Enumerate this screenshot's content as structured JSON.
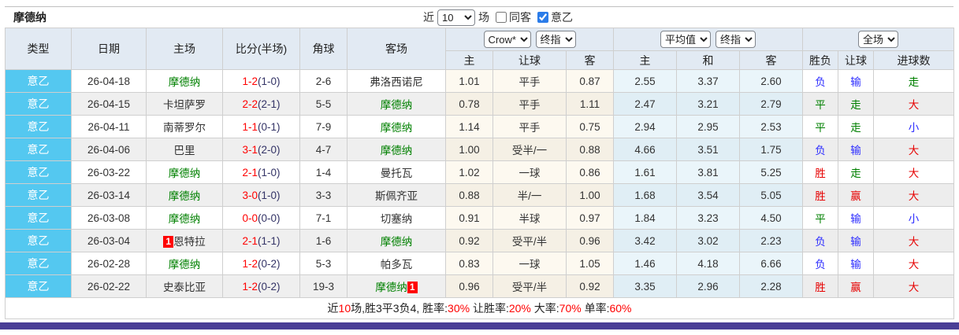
{
  "title": "摩德纳",
  "controls": {
    "recent_label": "近",
    "recent_value": "10",
    "unit_label": "场",
    "same_away_label": "同客",
    "same_away_checked": false,
    "league_filter_label": "意乙",
    "league_filter_checked": true
  },
  "table": {
    "col_headers": {
      "type": "类型",
      "date": "日期",
      "home": "主场",
      "score_half": "比分(半场)",
      "corner": "角球",
      "away": "客场",
      "odds_sub": [
        "主",
        "让球",
        "客"
      ],
      "avg_sub": [
        "主",
        "和",
        "客"
      ],
      "result_sub": [
        "胜负",
        "让球",
        "进球数"
      ]
    },
    "selects": {
      "odds_provider": "Crow*",
      "odds_stage": "终指",
      "avg_type": "平均值",
      "avg_stage": "终指",
      "scope": "全场"
    },
    "value_colors": {
      "胜": "red",
      "负": "blue",
      "平": "green",
      "赢": "red",
      "输": "blue",
      "走": "green",
      "大": "red",
      "小": "blue"
    },
    "rows": [
      {
        "type": "意乙",
        "date": "26-04-18",
        "home": {
          "name": "摩德纳"
        },
        "score_ft": "1-2",
        "score_ht": "1-0",
        "corner": "2-6",
        "away": {
          "name": "弗洛西诺尼"
        },
        "odds": [
          "1.01",
          "平手",
          "0.87"
        ],
        "avg": [
          "2.55",
          "3.37",
          "2.60"
        ],
        "result": [
          "负",
          "输",
          "走"
        ]
      },
      {
        "type": "意乙",
        "date": "26-04-15",
        "home": {
          "name": "卡坦萨罗"
        },
        "score_ft": "2-2",
        "score_ht": "2-1",
        "corner": "5-5",
        "away": {
          "name": "摩德纳"
        },
        "odds": [
          "0.78",
          "平手",
          "1.11"
        ],
        "avg": [
          "2.47",
          "3.21",
          "2.79"
        ],
        "result": [
          "平",
          "走",
          "大"
        ]
      },
      {
        "type": "意乙",
        "date": "26-04-11",
        "home": {
          "name": "南蒂罗尔"
        },
        "score_ft": "1-1",
        "score_ht": "0-1",
        "corner": "7-9",
        "away": {
          "name": "摩德纳"
        },
        "odds": [
          "1.14",
          "平手",
          "0.75"
        ],
        "avg": [
          "2.94",
          "2.95",
          "2.53"
        ],
        "result": [
          "平",
          "走",
          "小"
        ]
      },
      {
        "type": "意乙",
        "date": "26-04-06",
        "home": {
          "name": "巴里"
        },
        "score_ft": "3-1",
        "score_ht": "2-0",
        "corner": "4-7",
        "away": {
          "name": "摩德纳"
        },
        "odds": [
          "1.00",
          "受半/一",
          "0.88"
        ],
        "avg": [
          "4.66",
          "3.51",
          "1.75"
        ],
        "result": [
          "负",
          "输",
          "大"
        ]
      },
      {
        "type": "意乙",
        "date": "26-03-22",
        "home": {
          "name": "摩德纳"
        },
        "score_ft": "2-1",
        "score_ht": "1-0",
        "corner": "1-4",
        "away": {
          "name": "曼托瓦"
        },
        "odds": [
          "1.02",
          "一球",
          "0.86"
        ],
        "avg": [
          "1.61",
          "3.81",
          "5.25"
        ],
        "result": [
          "胜",
          "走",
          "大"
        ]
      },
      {
        "type": "意乙",
        "date": "26-03-14",
        "home": {
          "name": "摩德纳"
        },
        "score_ft": "3-0",
        "score_ht": "1-0",
        "corner": "3-3",
        "away": {
          "name": "斯佩齐亚"
        },
        "odds": [
          "0.88",
          "半/一",
          "1.00"
        ],
        "avg": [
          "1.68",
          "3.54",
          "5.05"
        ],
        "result": [
          "胜",
          "赢",
          "大"
        ]
      },
      {
        "type": "意乙",
        "date": "26-03-08",
        "home": {
          "name": "摩德纳"
        },
        "score_ft": "0-0",
        "score_ht": "0-0",
        "corner": "7-1",
        "away": {
          "name": "切塞纳"
        },
        "odds": [
          "0.91",
          "半球",
          "0.97"
        ],
        "avg": [
          "1.84",
          "3.23",
          "4.50"
        ],
        "result": [
          "平",
          "输",
          "小"
        ]
      },
      {
        "type": "意乙",
        "date": "26-03-04",
        "home": {
          "name": "恩特拉",
          "badge_before": "1"
        },
        "score_ft": "2-1",
        "score_ht": "1-1",
        "corner": "1-6",
        "away": {
          "name": "摩德纳"
        },
        "odds": [
          "0.92",
          "受平/半",
          "0.96"
        ],
        "avg": [
          "3.42",
          "3.02",
          "2.23"
        ],
        "result": [
          "负",
          "输",
          "大"
        ]
      },
      {
        "type": "意乙",
        "date": "26-02-28",
        "home": {
          "name": "摩德纳"
        },
        "score_ft": "1-2",
        "score_ht": "0-2",
        "corner": "5-3",
        "away": {
          "name": "帕多瓦"
        },
        "odds": [
          "0.83",
          "一球",
          "1.05"
        ],
        "avg": [
          "1.46",
          "4.18",
          "6.66"
        ],
        "result": [
          "负",
          "输",
          "大"
        ]
      },
      {
        "type": "意乙",
        "date": "26-02-22",
        "home": {
          "name": "史泰比亚"
        },
        "score_ft": "1-2",
        "score_ht": "0-2",
        "corner": "19-3",
        "away": {
          "name": "摩德纳",
          "badge_after": "1"
        },
        "odds": [
          "0.96",
          "受平/半",
          "0.92"
        ],
        "avg": [
          "3.35",
          "2.96",
          "2.28"
        ],
        "result": [
          "胜",
          "赢",
          "大"
        ]
      }
    ]
  },
  "summary": {
    "segments": [
      {
        "text": "近",
        "red": false
      },
      {
        "text": "10",
        "red": true
      },
      {
        "text": "场,胜3平3负4, 胜率:",
        "red": false
      },
      {
        "text": "30%",
        "red": true
      },
      {
        "text": " 让胜率:",
        "red": false
      },
      {
        "text": "20%",
        "red": true
      },
      {
        "text": " 大率:",
        "red": false
      },
      {
        "text": "70%",
        "red": true
      },
      {
        "text": " 单率:",
        "red": false
      },
      {
        "text": "60%",
        "red": true
      }
    ]
  },
  "colors": {
    "type_cell_bg": "#54c8f0",
    "header_bg": "#e2eaf3",
    "odds_col_bg": "#fdf9f0",
    "avg_col_bg": "#eaf5fa",
    "score_ft_red": "#ff0000",
    "focus_team_green": "#008000",
    "result_red": "#e60000",
    "result_blue": "#2b2bff",
    "result_green": "#008000",
    "bottom_bar": "#4a3e96",
    "checkbox_accent": "#2b7ce9"
  }
}
